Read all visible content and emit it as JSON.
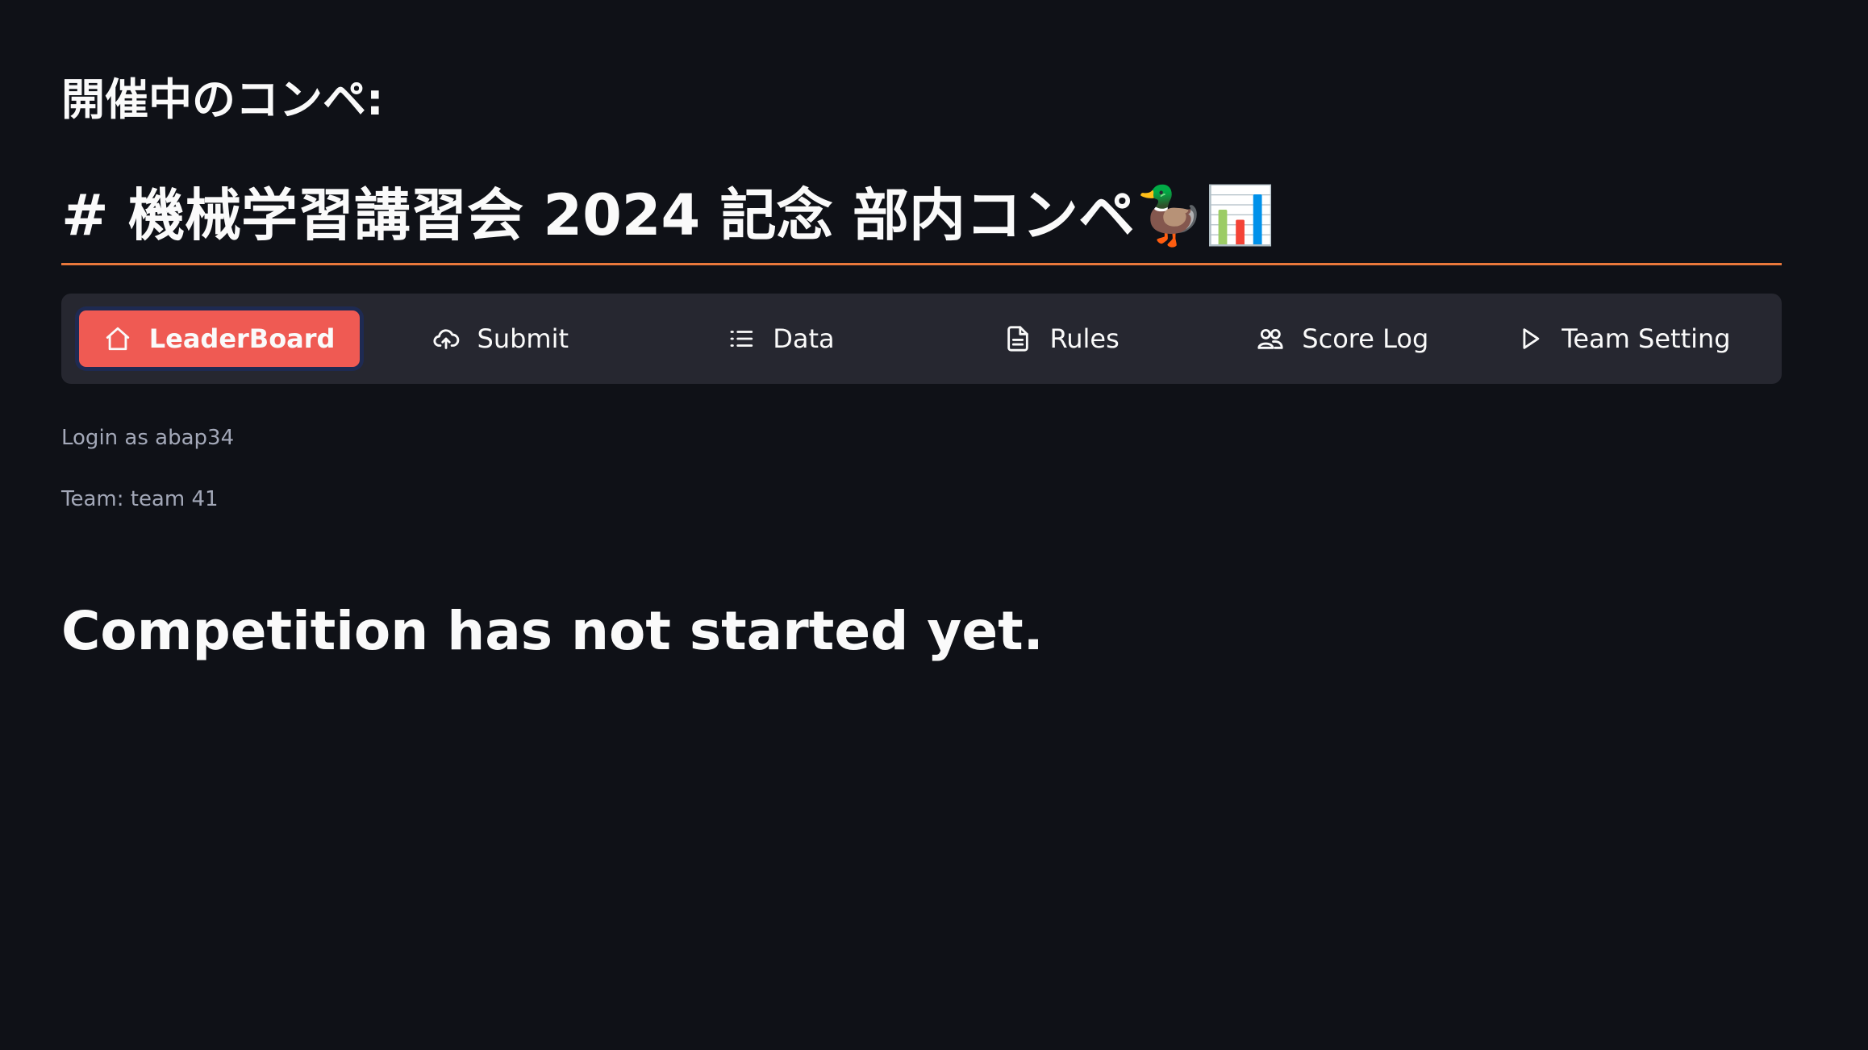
{
  "header": {
    "subheading": "開催中のコンペ:",
    "competition_title": "# 機械学習講習会 2024 記念 部内コンペ🦆📊"
  },
  "colors": {
    "background": "#0f1117",
    "accent_rule": "#e8773b",
    "nav_background": "#262730",
    "active_tab": "#ef5a53"
  },
  "nav": {
    "items": [
      {
        "label": "LeaderBoard",
        "icon": "home-icon",
        "active": true
      },
      {
        "label": "Submit",
        "icon": "cloud-upload-icon",
        "active": false
      },
      {
        "label": "Data",
        "icon": "list-icon",
        "active": false
      },
      {
        "label": "Rules",
        "icon": "document-icon",
        "active": false
      },
      {
        "label": "Score Log",
        "icon": "people-icon",
        "active": false
      },
      {
        "label": "Team Setting",
        "icon": "play-icon",
        "active": false
      }
    ]
  },
  "user": {
    "login_text": "Login as abap34",
    "team_text": "Team: team 41"
  },
  "main": {
    "status_message": "Competition has not started yet."
  }
}
